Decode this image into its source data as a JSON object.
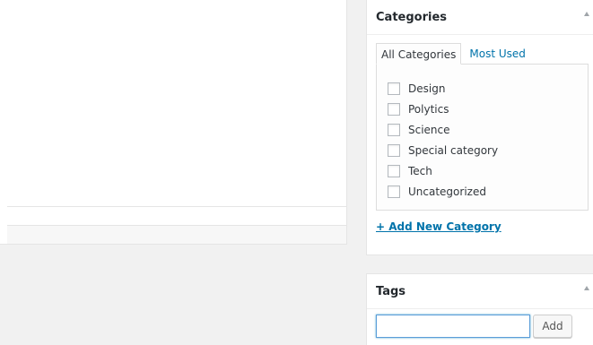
{
  "categories_box": {
    "title": "Categories",
    "tabs": [
      {
        "label": "All Categories",
        "active": true
      },
      {
        "label": "Most Used",
        "active": false
      }
    ],
    "items": [
      {
        "label": "Design",
        "checked": false
      },
      {
        "label": "Polytics",
        "checked": false
      },
      {
        "label": "Science",
        "checked": false
      },
      {
        "label": "Special category",
        "checked": false
      },
      {
        "label": "Tech",
        "checked": false
      },
      {
        "label": "Uncategorized",
        "checked": false
      }
    ],
    "add_link": "+ Add New Category"
  },
  "tags_box": {
    "title": "Tags",
    "input_value": "",
    "add_button": "Add"
  },
  "icons": {
    "toggle": "triangle-up-icon"
  },
  "colors": {
    "link": "#0073aa",
    "focus_border": "#5b9dd9",
    "background": "#f1f1f1"
  }
}
